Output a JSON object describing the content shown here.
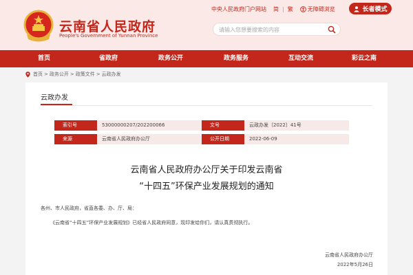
{
  "header": {
    "site_title_cn": "云南省人民政府",
    "site_title_en": "People's Government of Yunnan Province",
    "top_links": [
      "中央人民政府门户网站",
      "简",
      "繁",
      "无障碍浏览"
    ],
    "elder_mode_label": "长者模式",
    "search_placeholder": "请输入您想要搜索的内容",
    "brand_color": "#c3271b"
  },
  "nav": {
    "items": [
      "首页",
      "省政府",
      "政务公开",
      "政务服务",
      "互动交流",
      "彩云之南"
    ]
  },
  "breadcrumb": {
    "items": [
      "首页",
      "政务公开",
      "政策文件",
      "云政办发"
    ]
  },
  "section": {
    "heading": "云政办发"
  },
  "meta": {
    "index_label": "索引号",
    "index_value": "53000000207/202200066",
    "doc_no_label": "文号",
    "doc_no_value": "云政办发〔2022〕41号",
    "source_label": "来源",
    "source_value": "云南省人民政府办公厅",
    "date_label": "公开日期",
    "date_value": "2022-06-09"
  },
  "document": {
    "title_line1": "云南省人民政府办公厅关于印发云南省",
    "title_line2": "“十四五”环保产业发展规划的通知",
    "recipients": "各州、市人民政府，省直各委、办、厅、局：",
    "body": "《云南省“十四五”环保产业发展规划》已经省人民政府同意，现印发给你们，请认真贯彻执行。",
    "signature": "云南省人民政府办公厅",
    "date": "2022年5月26日"
  }
}
